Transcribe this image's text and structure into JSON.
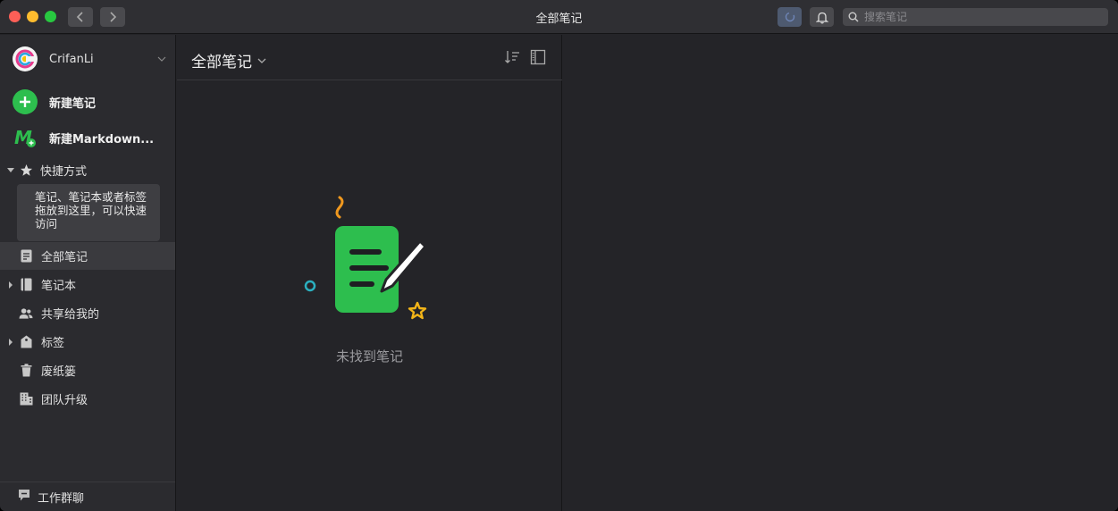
{
  "window": {
    "title": "全部笔记"
  },
  "search": {
    "placeholder": "搜索笔记"
  },
  "account": {
    "name": "CrifanLi"
  },
  "sidebar": {
    "new_note": "新建笔记",
    "new_markdown": "新建Markdown...",
    "shortcuts_label": "快捷方式",
    "shortcuts_hint": "笔记、笔记本或者标签拖放到这里，可以快速访问",
    "items": [
      {
        "label": "全部笔记",
        "icon": "note-icon",
        "active": true
      },
      {
        "label": "笔记本",
        "icon": "notebook-icon",
        "expandable": true
      },
      {
        "label": "共享给我的",
        "icon": "shared-users-icon"
      },
      {
        "label": "标签",
        "icon": "tag-icon",
        "expandable": true
      },
      {
        "label": "废纸篓",
        "icon": "trash-icon"
      },
      {
        "label": "团队升级",
        "icon": "building-icon"
      }
    ],
    "work_chat": "工作群聊"
  },
  "note_list": {
    "title": "全部笔记",
    "empty_text": "未找到笔记"
  },
  "colors": {
    "accent_green": "#2dbe4e",
    "background": "#242428",
    "sidebar": "#2b2b2f"
  }
}
